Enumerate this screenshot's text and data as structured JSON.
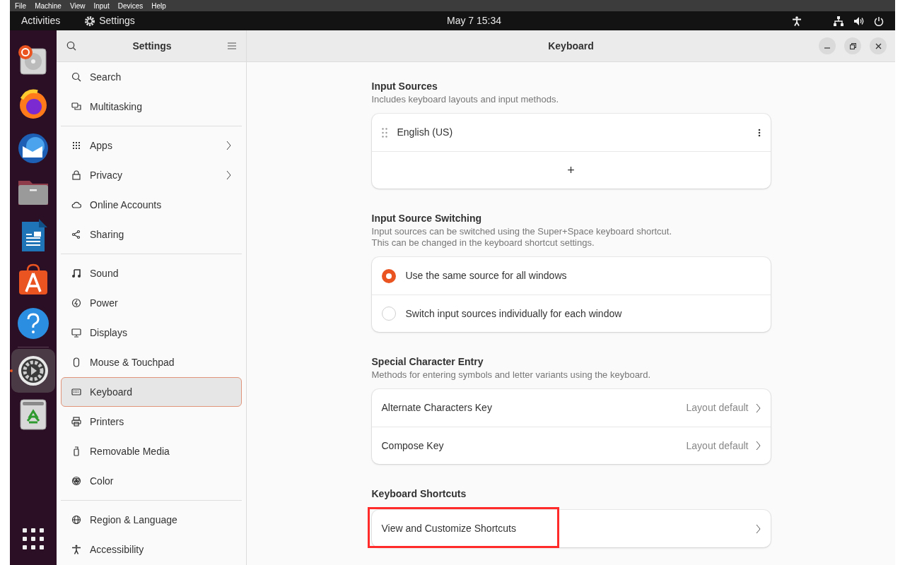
{
  "vm_menu": [
    "File",
    "Machine",
    "View",
    "Input",
    "Devices",
    "Help"
  ],
  "top_bar": {
    "activities": "Activities",
    "app": "Settings",
    "clock": "May 7  15:34"
  },
  "dock": {
    "items": [
      {
        "selected": false,
        "running": false
      },
      {
        "selected": false,
        "running": false
      },
      {
        "selected": false,
        "running": false
      },
      {
        "selected": false,
        "running": false
      },
      {
        "selected": false,
        "running": false
      },
      {
        "selected": false,
        "running": false
      },
      {
        "selected": false,
        "running": false
      },
      {
        "selected": true,
        "running": true
      },
      {
        "selected": false,
        "running": false
      }
    ]
  },
  "sidebar": {
    "title": "Settings",
    "groups": [
      [
        {
          "label": "Search",
          "selected": false,
          "submenu": false
        },
        {
          "label": "Multitasking",
          "selected": false,
          "submenu": false
        }
      ],
      [
        {
          "label": "Apps",
          "selected": false,
          "submenu": true
        },
        {
          "label": "Privacy",
          "selected": false,
          "submenu": true
        },
        {
          "label": "Online Accounts",
          "selected": false,
          "submenu": false
        },
        {
          "label": "Sharing",
          "selected": false,
          "submenu": false
        }
      ],
      [
        {
          "label": "Sound",
          "selected": false,
          "submenu": false
        },
        {
          "label": "Power",
          "selected": false,
          "submenu": false
        },
        {
          "label": "Displays",
          "selected": false,
          "submenu": false
        },
        {
          "label": "Mouse & Touchpad",
          "selected": false,
          "submenu": false
        },
        {
          "label": "Keyboard",
          "selected": true,
          "submenu": false
        },
        {
          "label": "Printers",
          "selected": false,
          "submenu": false
        },
        {
          "label": "Removable Media",
          "selected": false,
          "submenu": false
        },
        {
          "label": "Color",
          "selected": false,
          "submenu": false
        }
      ],
      [
        {
          "label": "Region & Language",
          "selected": false,
          "submenu": false
        },
        {
          "label": "Accessibility",
          "selected": false,
          "submenu": false
        }
      ]
    ]
  },
  "window": {
    "title": "Keyboard"
  },
  "sections": [
    {
      "title": "Input Sources",
      "description": [
        "Includes keyboard layouts and input methods."
      ],
      "rows": [
        {
          "kind": "source",
          "label": "English (US)"
        },
        {
          "kind": "add",
          "label": "+"
        }
      ]
    },
    {
      "title": "Input Source Switching",
      "description": [
        "Input sources can be switched using the Super+Space keyboard shortcut.",
        "This can be changed in the keyboard shortcut settings."
      ],
      "rows": [
        {
          "kind": "radio",
          "label": "Use the same source for all windows",
          "selected": true
        },
        {
          "kind": "radio",
          "label": "Switch input sources individually for each window",
          "selected": false
        }
      ]
    },
    {
      "title": "Special Character Entry",
      "description": [
        "Methods for entering symbols and letter variants using the keyboard."
      ],
      "rows": [
        {
          "kind": "link",
          "label": "Alternate Characters Key",
          "value": "Layout default"
        },
        {
          "kind": "link",
          "label": "Compose Key",
          "value": "Layout default"
        }
      ]
    },
    {
      "title": "Keyboard Shortcuts",
      "rows": [
        {
          "kind": "link",
          "label": "View and Customize Shortcuts",
          "highlighted": true
        }
      ]
    }
  ]
}
